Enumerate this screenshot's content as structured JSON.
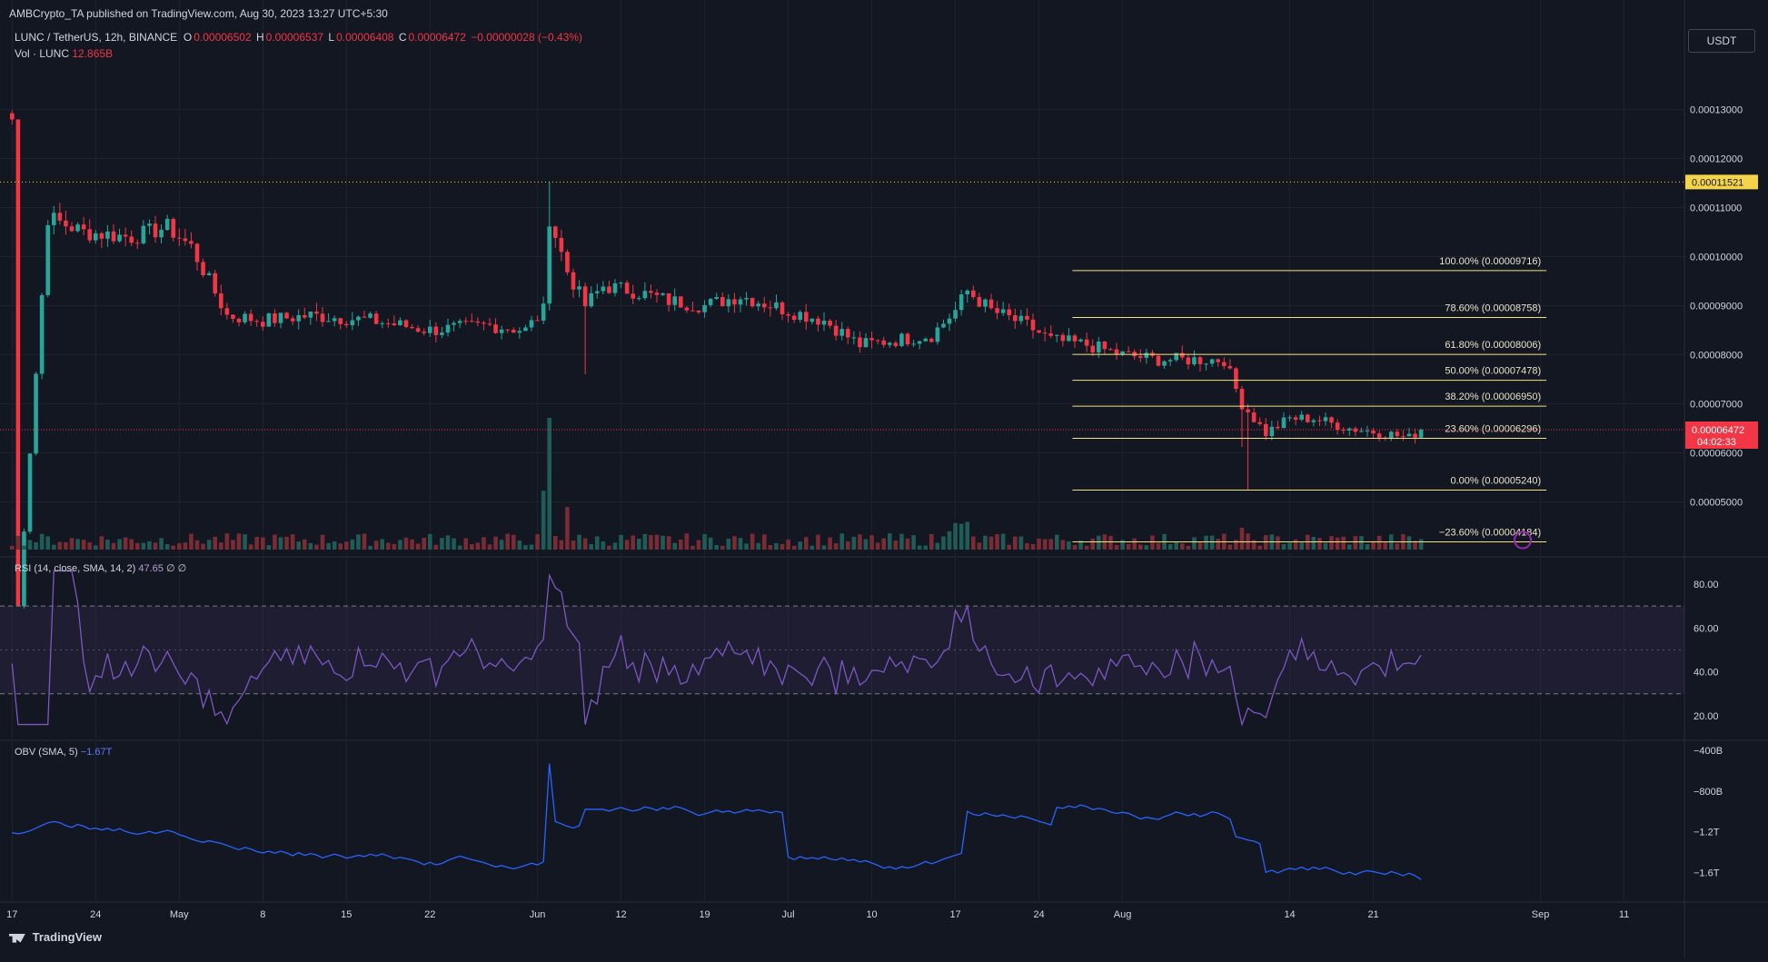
{
  "publisher_line": "AMBCrypto_TA published on TradingView.com, Aug 30, 2023 13:27 UTC+5:30",
  "symbol": "LUNC / TetherUS, 12h, BINANCE",
  "ohlc": {
    "o_label": "O",
    "o": "0.00006502",
    "h_label": "H",
    "h": "0.00006537",
    "l_label": "L",
    "l": "0.00006408",
    "c_label": "C",
    "c": "0.00006472",
    "chg": "−0.00000028 (−0.43%)"
  },
  "volume_legend": {
    "label": "Vol · LUNC",
    "value": "12.865B"
  },
  "currency_button": "USDT",
  "logo_text": "TradingView",
  "price_labels": {
    "resistance": "0.00011521",
    "last": "0.00006472",
    "countdown": "04:02:33"
  },
  "colors": {
    "up": "#26a69a",
    "down": "#f23645",
    "fib": "#f5e27c",
    "rsi": "#7e57c2",
    "obv": "#2962ff",
    "bg": "#131722",
    "grid": "#1e222d",
    "axis_text": "#d1d4dc",
    "resistance": "#f5d547"
  },
  "rsi_legend": {
    "label": "RSI (14, close, SMA, 14, 2)",
    "value": "47.65",
    "extra": "∅ ∅"
  },
  "obv_legend": {
    "label": "OBV (SMA, 5)",
    "value": "−1.67T"
  },
  "chart_data": [
    {
      "type": "candlestick",
      "title": "LUNC / TetherUS, 12h, BINANCE",
      "ylim": [
        4.12e-05,
        0.0001375
      ],
      "y_ticks": [
        "0.00013000",
        "0.00012000",
        "0.00011000",
        "0.00010000",
        "0.00009000",
        "0.00008000",
        "0.00007000",
        "0.00006000",
        "0.00005000"
      ],
      "y_tick_values": [
        0.00013,
        0.00012,
        0.00011,
        0.0001,
        9e-05,
        8e-05,
        7e-05,
        6e-05,
        5e-05
      ],
      "x_ticks": [
        "17",
        "24",
        "May",
        "8",
        "15",
        "22",
        "Jun",
        "12",
        "19",
        "Jul",
        "10",
        "17",
        "24",
        "Aug",
        "14",
        "21",
        "Sep",
        "11"
      ],
      "x_tick_pos": [
        0,
        14,
        28,
        42,
        56,
        70,
        88,
        102,
        116,
        130,
        144,
        158,
        172,
        186,
        214,
        228,
        256,
        270
      ],
      "horizontal_line": {
        "value": 0.00011521,
        "label": "0.00011521"
      },
      "fibonacci": [
        {
          "label": "100.00% (0.00009716)",
          "value": 9.716e-05
        },
        {
          "label": "78.60% (0.00008758)",
          "value": 8.758e-05
        },
        {
          "label": "61.80% (0.00008006)",
          "value": 8.006e-05
        },
        {
          "label": "50.00% (0.00007478)",
          "value": 7.478e-05
        },
        {
          "label": "38.20% (0.00006950)",
          "value": 6.95e-05
        },
        {
          "label": "23.60% (0.00006296)",
          "value": 6.296e-05
        },
        {
          "label": "0.00% (0.00005240)",
          "value": 5.24e-05
        },
        {
          "label": "−23.60% (0.00004184)",
          "value": 4.184e-05
        }
      ],
      "fib_start_index": 178,
      "key_closes": [
        [
          0,
          1.28e-05
        ],
        [
          6,
          0.000108
        ],
        [
          12,
          0.000105
        ],
        [
          20,
          0.000104
        ],
        [
          26,
          0.000106
        ],
        [
          30,
          0.000102
        ],
        [
          36,
          8.8e-05
        ],
        [
          42,
          8.7e-05
        ],
        [
          50,
          8.8e-05
        ],
        [
          60,
          8.7e-05
        ],
        [
          70,
          8.5e-05
        ],
        [
          80,
          8.6e-05
        ],
        [
          86,
          8.5e-05
        ],
        [
          89,
          8.9e-05
        ],
        [
          90,
          0.000108
        ],
        [
          93,
          9.7e-05
        ],
        [
          96,
          9e-05
        ],
        [
          99,
          9.4e-05
        ],
        [
          104,
          9.3e-05
        ],
        [
          110,
          9.1e-05
        ],
        [
          116,
          9e-05
        ],
        [
          122,
          9.2e-05
        ],
        [
          130,
          8.9e-05
        ],
        [
          136,
          8.7e-05
        ],
        [
          142,
          8.2e-05
        ],
        [
          148,
          8.3e-05
        ],
        [
          154,
          8.4e-05
        ],
        [
          158,
          8.9e-05
        ],
        [
          160,
          9.3e-05
        ],
        [
          164,
          8.9e-05
        ],
        [
          170,
          8.6e-05
        ],
        [
          174,
          8.3e-05
        ],
        [
          180,
          8.2e-05
        ],
        [
          186,
          8e-05
        ],
        [
          192,
          7.9e-05
        ],
        [
          198,
          7.9e-05
        ],
        [
          203,
          7.9e-05
        ],
        [
          206,
          7e-05
        ],
        [
          210,
          6.4e-05
        ],
        [
          214,
          6.7e-05
        ],
        [
          218,
          6.7e-05
        ],
        [
          224,
          6.5e-05
        ],
        [
          230,
          6.4e-05
        ],
        [
          234,
          6.3e-05
        ],
        [
          236,
          6.5e-05
        ]
      ]
    },
    {
      "type": "line",
      "title": "RSI (14, close, SMA, 14, 2)",
      "ylim": [
        15,
        87
      ],
      "y_ticks": [
        "80.00",
        "60.00",
        "40.00",
        "20.00"
      ],
      "y_tick_values": [
        80,
        60,
        40,
        20
      ],
      "band": [
        30,
        70
      ],
      "middle": 50,
      "last_value": 47.65
    },
    {
      "type": "line",
      "title": "OBV (SMA, 5)",
      "ylim": [
        -1.82,
        -0.4
      ],
      "y_ticks": [
        "−400B",
        "−800B",
        "−1.2T",
        "−1.6T"
      ],
      "y_tick_values": [
        -0.4,
        -0.8,
        -1.2,
        -1.6
      ],
      "last_value": -1.67
    }
  ]
}
